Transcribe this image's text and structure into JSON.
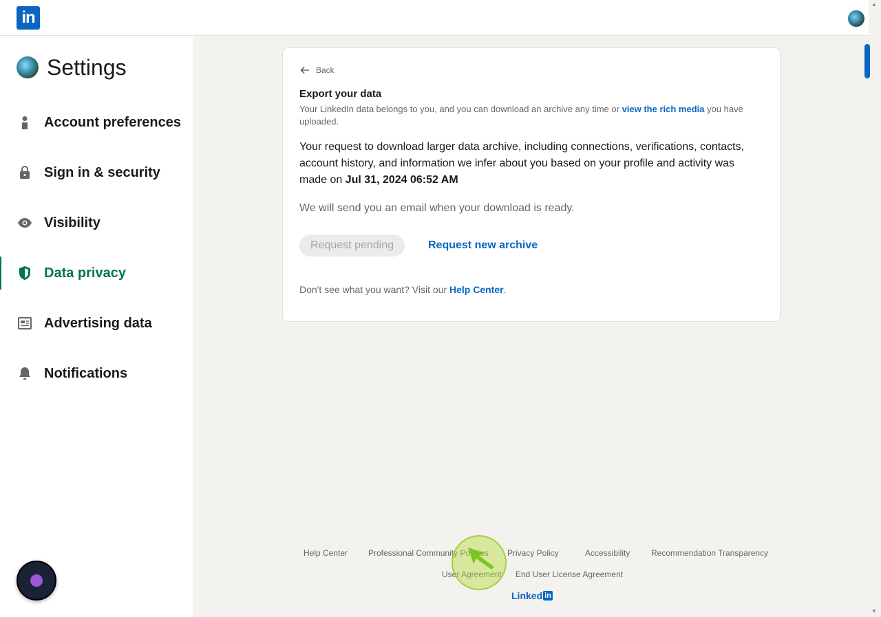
{
  "header": {
    "logo_text": "in"
  },
  "sidebar": {
    "title": "Settings",
    "items": [
      {
        "label": "Account preferences",
        "icon": "person-icon",
        "active": false
      },
      {
        "label": "Sign in & security",
        "icon": "lock-icon",
        "active": false
      },
      {
        "label": "Visibility",
        "icon": "eye-icon",
        "active": false
      },
      {
        "label": "Data privacy",
        "icon": "shield-icon",
        "active": true
      },
      {
        "label": "Advertising data",
        "icon": "newspaper-icon",
        "active": false
      },
      {
        "label": "Notifications",
        "icon": "bell-icon",
        "active": false
      }
    ]
  },
  "main": {
    "back_label": "Back",
    "title": "Export your data",
    "desc_part1": "Your LinkedIn data belongs to you, and you can download an archive any time or ",
    "desc_link": "view the rich media",
    "desc_part2": " you have uploaded.",
    "request_text": "Your request to download larger data archive, including connections, verifications, contacts, account history, and information we infer about you based on your profile and activity was made on ",
    "request_date": "Jul 31, 2024 06:52 AM",
    "email_note": "We will send you an email when your download is ready.",
    "pending_button": "Request pending",
    "new_archive_link": "Request new archive",
    "help_prefix": "Don't see what you want? Visit our ",
    "help_link": "Help Center",
    "help_suffix": "."
  },
  "footer": {
    "links_row1": [
      "Help Center",
      "Professional Community Policies",
      "Privacy Policy",
      "Accessibility",
      "Recommendation Transparency"
    ],
    "links_row2": [
      "User Agreement",
      "End User License Agreement"
    ],
    "logo_text": "Linked",
    "logo_box": "in"
  },
  "colors": {
    "brand": "#0a66c2",
    "active_nav": "#01754f",
    "page_bg": "#f4f2ee"
  }
}
